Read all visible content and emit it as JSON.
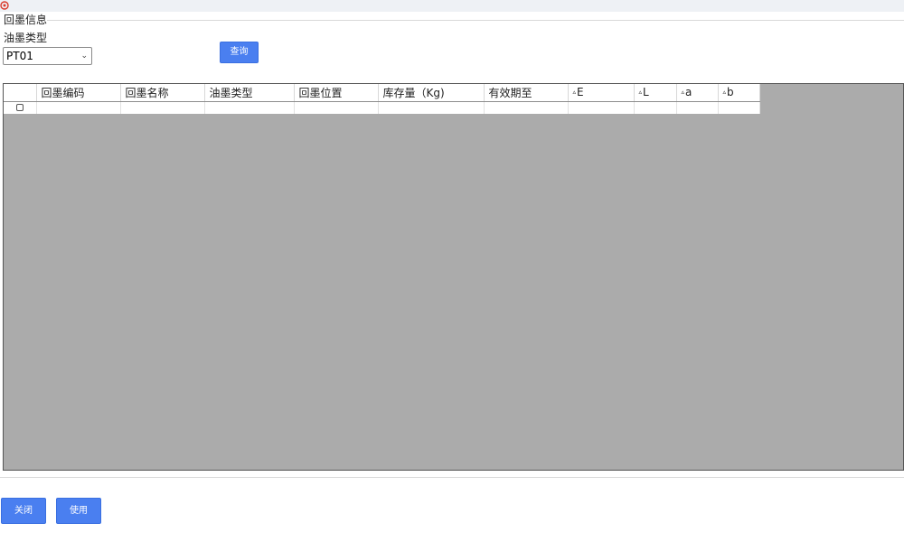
{
  "window": {
    "icon": "app-logo-icon"
  },
  "group": {
    "title": "回墨信息"
  },
  "filter": {
    "ink_type_label": "油墨类型",
    "ink_type_value": "PT01",
    "query_label": "查询"
  },
  "table": {
    "columns": [
      {
        "label": "回墨编码",
        "prefix": ""
      },
      {
        "label": "回墨名称",
        "prefix": ""
      },
      {
        "label": "油墨类型",
        "prefix": ""
      },
      {
        "label": "回墨位置",
        "prefix": ""
      },
      {
        "label": "库存量（Kg)",
        "prefix": ""
      },
      {
        "label": "有效期至",
        "prefix": ""
      },
      {
        "label": "E",
        "prefix": "▵"
      },
      {
        "label": "L",
        "prefix": "▵"
      },
      {
        "label": "a",
        "prefix": "▵"
      },
      {
        "label": "b",
        "prefix": "▵"
      }
    ]
  },
  "actions": {
    "close_label": "关闭",
    "use_label": "使用"
  },
  "colors": {
    "accent": "#4a7ff0",
    "grid_background": "#ababab"
  }
}
